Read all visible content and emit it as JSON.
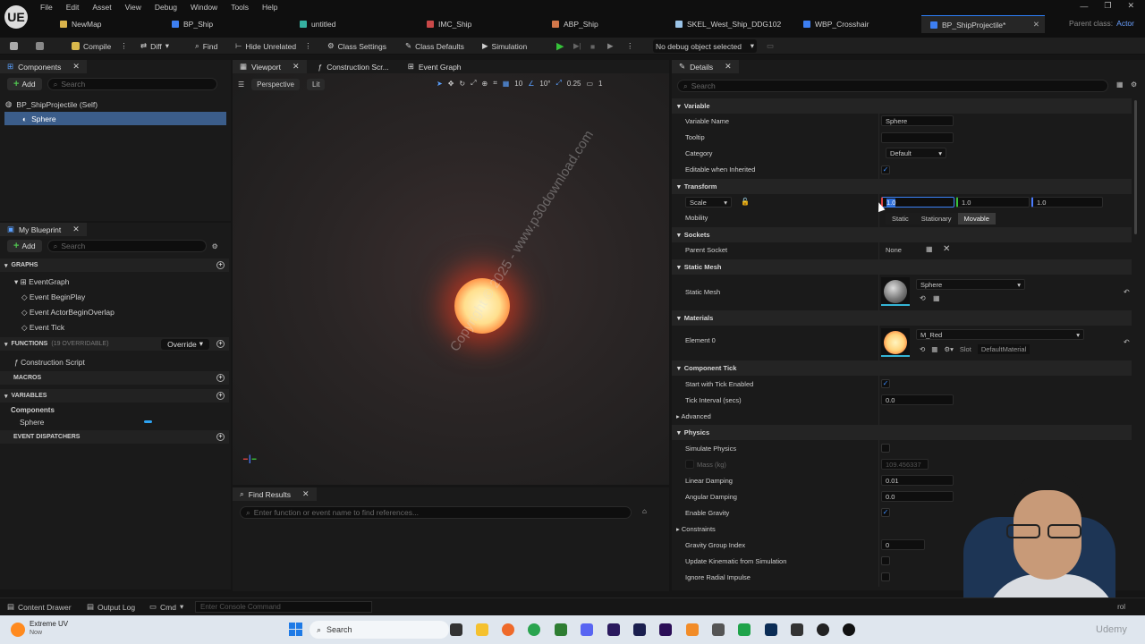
{
  "app": {
    "logo": "UE"
  },
  "menu": [
    "File",
    "Edit",
    "Asset",
    "View",
    "Debug",
    "Window",
    "Tools",
    "Help"
  ],
  "window_controls": [
    "—",
    "❐",
    "✕"
  ],
  "tabs": [
    {
      "label": "NewMap",
      "icon": "map-icon",
      "color": "#d9b34b"
    },
    {
      "label": "BP_Ship",
      "icon": "blueprint-icon",
      "color": "#3d7ff2"
    },
    {
      "label": "untitled",
      "icon": "asset-icon",
      "color": "#35b0a0"
    },
    {
      "label": "IMC_Ship",
      "icon": "input-icon",
      "color": "#c94848"
    },
    {
      "label": "ABP_Ship",
      "icon": "anim-icon",
      "color": "#d2774a"
    },
    {
      "label": "SKEL_West_Ship_DDG102",
      "icon": "skeleton-icon",
      "color": "#9bc4e8"
    },
    {
      "label": "WBP_Crosshair",
      "icon": "widget-icon",
      "color": "#3d7ff2"
    },
    {
      "label": "BP_ShipProjectile*",
      "icon": "blueprint-icon",
      "color": "#3d7ff2"
    }
  ],
  "parent_class": {
    "label": "Parent class:",
    "value": "Actor"
  },
  "toolbar": {
    "compile": "Compile",
    "diff": "Diff",
    "find": "Find",
    "hide_unrelated": "Hide Unrelated",
    "class_settings": "Class Settings",
    "class_defaults": "Class Defaults",
    "simulation": "Simulation",
    "debug_object": "No debug object selected"
  },
  "components_panel": {
    "title": "Components",
    "add": "Add",
    "search_placeholder": "Search",
    "root": "BP_ShipProjectile (Self)",
    "child": "Sphere"
  },
  "my_blueprint": {
    "title": "My Blueprint",
    "add": "Add",
    "search_placeholder": "Search",
    "graphs_label": "GRAPHS",
    "graph": "EventGraph",
    "events": [
      "Event BeginPlay",
      "Event ActorBeginOverlap",
      "Event Tick"
    ],
    "functions_label": "FUNCTIONS",
    "functions_note": "(19 OVERRIDABLE)",
    "override": "Override",
    "construction": "Construction Script",
    "macros": "MACROS",
    "variables": "VARIABLES",
    "components_cat": "Components",
    "var_sphere": "Sphere",
    "dispatchers": "EVENT DISPATCHERS"
  },
  "viewport": {
    "tabs": [
      "Viewport",
      "Construction Scr...",
      "Event Graph"
    ],
    "perspective": "Perspective",
    "lit": "Lit",
    "grid": "10",
    "angle": "10°",
    "scale": "0.25",
    "cams": "1",
    "watermark": "Copyright © 2025 - www.p30download.com"
  },
  "find_results": {
    "title": "Find Results",
    "placeholder": "Enter function or event name to find references..."
  },
  "details": {
    "title": "Details",
    "search_placeholder": "Search",
    "variable": "Variable",
    "variable_name_label": "Variable Name",
    "variable_name": "Sphere",
    "tooltip_label": "Tooltip",
    "category_label": "Category",
    "category": "Default",
    "editable_label": "Editable when Inherited",
    "transform": "Transform",
    "scale_label": "Scale",
    "scale_x": "1.0",
    "scale_y": "1.0",
    "scale_z": "1.0",
    "mobility_label": "Mobility",
    "mobility_options": [
      "Static",
      "Stationary",
      "Movable"
    ],
    "sockets": "Sockets",
    "parent_socket_label": "Parent Socket",
    "parent_socket": "None",
    "static_mesh_cat": "Static Mesh",
    "static_mesh_label": "Static Mesh",
    "static_mesh": "Sphere",
    "materials": "Materials",
    "element0_label": "Element 0",
    "material": "M_Red",
    "slot_label": "Slot",
    "slot": "DefaultMaterial",
    "component_tick": "Component Tick",
    "start_tick_label": "Start with Tick Enabled",
    "tick_interval_label": "Tick Interval (secs)",
    "tick_interval": "0.0",
    "advanced": "Advanced",
    "physics": "Physics",
    "simulate_label": "Simulate Physics",
    "mass_label": "Mass (kg)",
    "mass": "109.456337",
    "linear_damping_label": "Linear Damping",
    "linear_damping": "0.01",
    "angular_damping_label": "Angular Damping",
    "angular_damping": "0.0",
    "gravity_label": "Enable Gravity",
    "constraints": "Constraints",
    "gravity_group_label": "Gravity Group Index",
    "gravity_group": "0",
    "kinematic_label": "Update Kinematic from Simulation",
    "radial_label": "Ignore Radial Impulse"
  },
  "statusbar": {
    "content_drawer": "Content Drawer",
    "output_log": "Output Log",
    "cmd": "Cmd",
    "console_placeholder": "Enter Console Command",
    "trail": "rol"
  },
  "taskbar": {
    "weather_title": "Extreme UV",
    "weather_sub": "Now",
    "search": "Search",
    "watermark": "Udemy"
  }
}
